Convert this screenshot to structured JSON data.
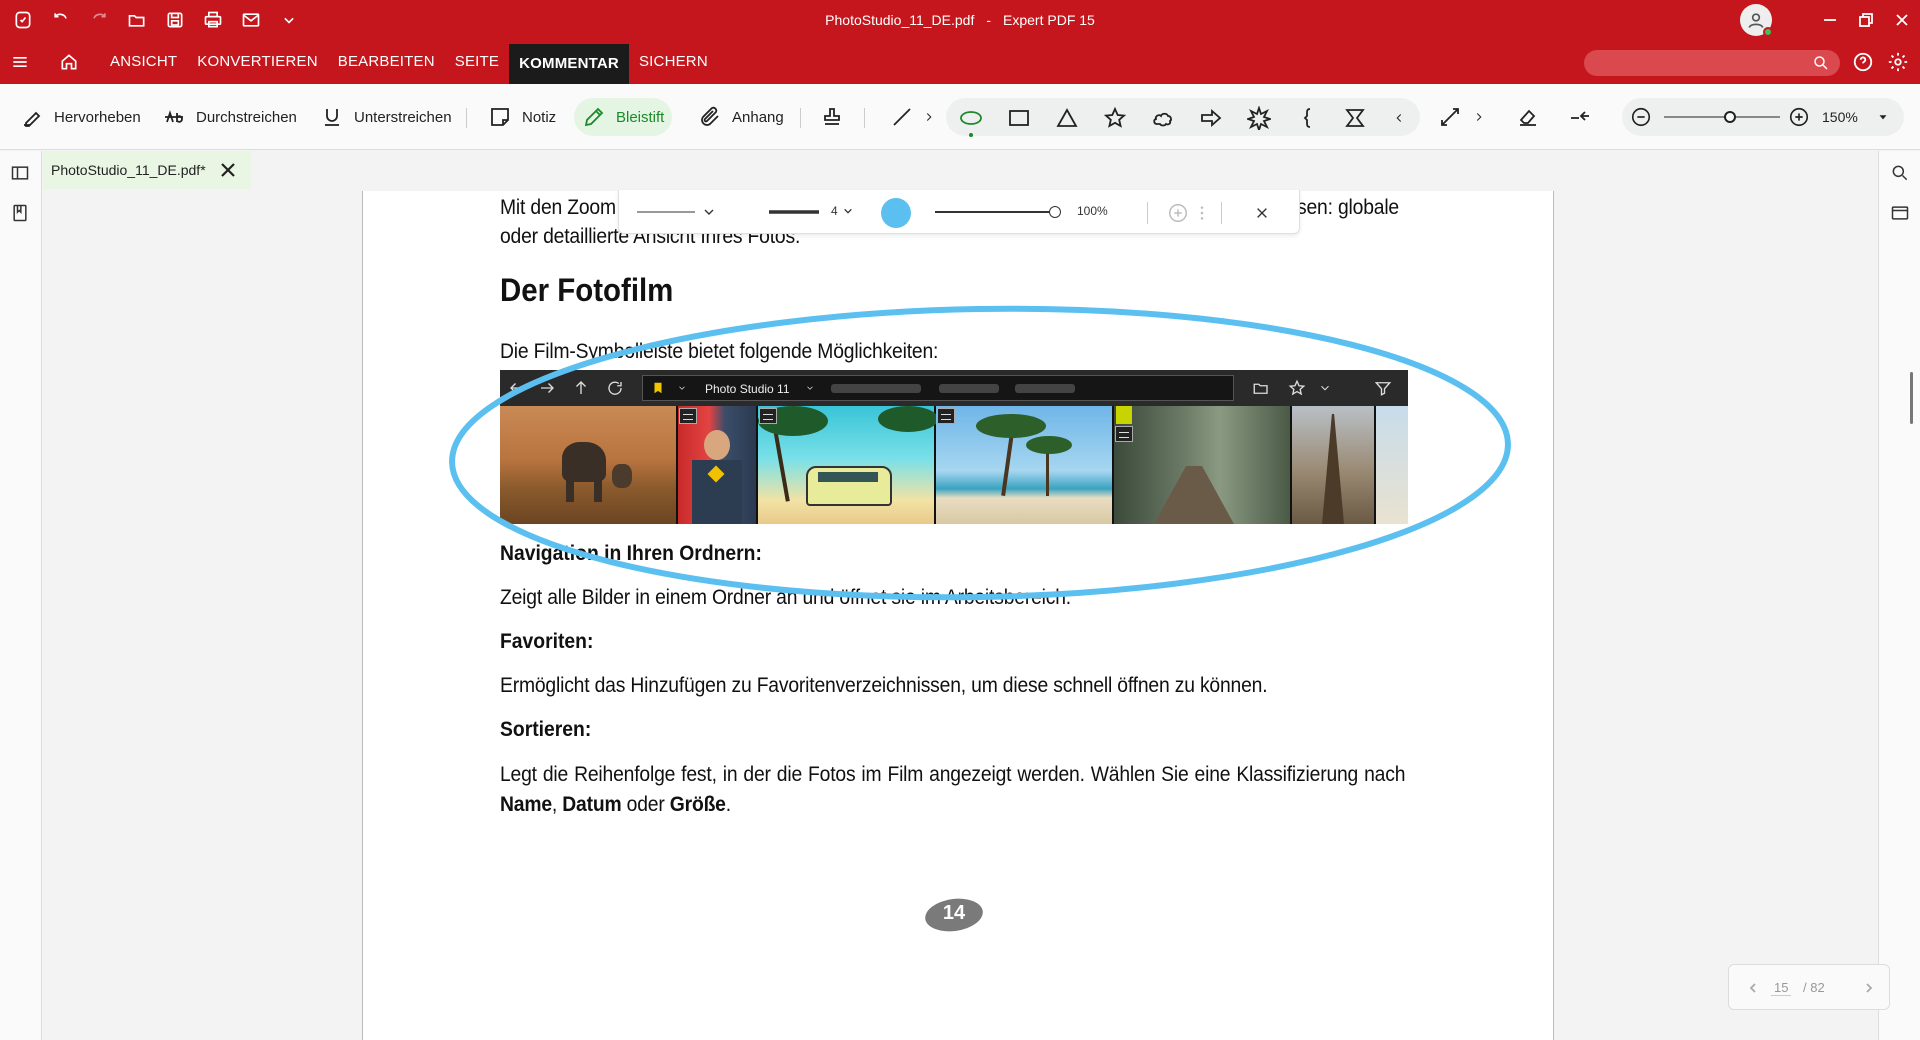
{
  "app": {
    "file_name": "PhotoStudio_11_DE.pdf",
    "separator": "-",
    "app_name": "Expert PDF 15"
  },
  "menu": {
    "items": [
      "ANSICHT",
      "KONVERTIEREN",
      "BEARBEITEN",
      "SEITE",
      "KOMMENTAR",
      "SICHERN"
    ],
    "active": "KOMMENTAR"
  },
  "ribbon": {
    "highlight": "Hervorheben",
    "strikethrough": "Durchstreichen",
    "underline": "Unterstreichen",
    "note": "Notiz",
    "pencil": "Bleistift",
    "attachment": "Anhang",
    "zoom": "150%"
  },
  "tab": {
    "label": "PhotoStudio_11_DE.pdf*"
  },
  "format_toolbar": {
    "line_width": "4",
    "opacity": "100%",
    "color": "#5bc0f0"
  },
  "document": {
    "line1_left": "Mit den Zoom",
    "line1_right": "sen: globale",
    "line2": "oder detaillierte Ansicht Ihres Fotos.",
    "heading": "Der Fotofilm",
    "intro": "Die Film-Symbolleiste bietet folgende Möglichkeiten:",
    "film_address": "Photo Studio 11",
    "nav_heading": "Navigation in Ihren Ordnern:",
    "nav_text": "Zeigt alle Bilder in einem Ordner an und öffnet sie im Arbeitsbereich.",
    "fav_heading": "Favoriten:",
    "fav_text": "Ermöglicht das Hinzufügen zu Favoritenverzeichnissen, um diese schnell öffnen zu können.",
    "sort_heading": "Sortieren:",
    "sort_text_1": "Legt die Reihenfolge fest, in der die Fotos im Film angezeigt werden. Wählen Sie eine Klassifizierung nach ",
    "sort_bold_name": "Name",
    "sort_comma": ", ",
    "sort_bold_date": "Datum",
    "sort_or": " oder ",
    "sort_bold_size": "Größe",
    "sort_end": ".",
    "page_number": "14"
  },
  "pager": {
    "current": "15",
    "total": "/ 82"
  },
  "colors": {
    "brand_red": "#c4161c",
    "active_green": "#1d8a2a",
    "annotation_blue": "#5bc0f0"
  }
}
